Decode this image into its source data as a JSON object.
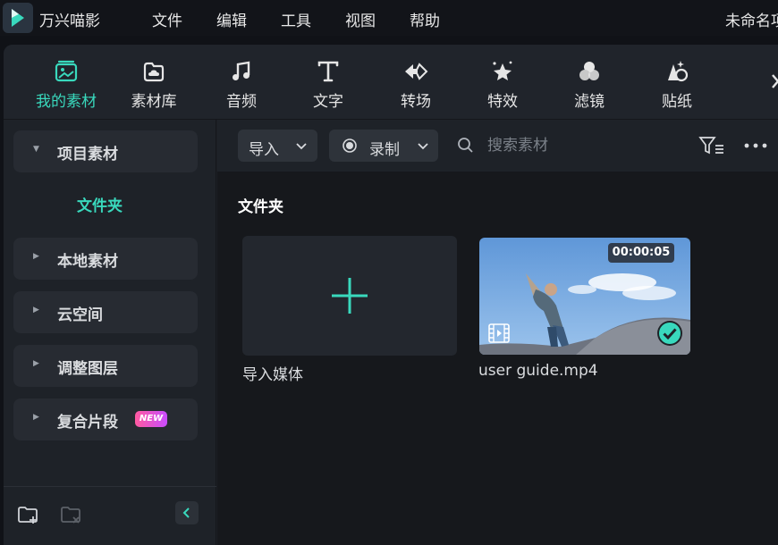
{
  "app": {
    "name": "万兴喵影",
    "project_title": "未命名项",
    "menu": [
      "文件",
      "编辑",
      "工具",
      "视图",
      "帮助"
    ]
  },
  "toolbar": {
    "tabs": [
      {
        "label": "我的素材",
        "icon": "my-media-icon",
        "active": true
      },
      {
        "label": "素材库",
        "icon": "stock-library-icon",
        "active": false
      },
      {
        "label": "音频",
        "icon": "music-note-icon",
        "active": false
      },
      {
        "label": "文字",
        "icon": "text-t-icon",
        "active": false
      },
      {
        "label": "转场",
        "icon": "transition-icon",
        "active": false
      },
      {
        "label": "特效",
        "icon": "sparkle-star-icon",
        "active": false
      },
      {
        "label": "滤镜",
        "icon": "filter-circles-icon",
        "active": false
      },
      {
        "label": "贴纸",
        "icon": "sticker-icon",
        "active": false
      }
    ]
  },
  "sidebar": {
    "items": [
      {
        "label": "项目素材",
        "expanded": true
      },
      {
        "label": "本地素材",
        "expanded": false
      },
      {
        "label": "云空间",
        "expanded": false
      },
      {
        "label": "调整图层",
        "expanded": false
      },
      {
        "label": "复合片段",
        "expanded": false,
        "badge": "NEW"
      }
    ],
    "sub_item": "文件夹"
  },
  "content": {
    "import_label": "导入",
    "record_label": "录制",
    "search_placeholder": "搜索素材",
    "section_title": "文件夹",
    "media": [
      {
        "label": "导入媒体",
        "type": "import"
      },
      {
        "label": "user guide.mp4",
        "type": "video",
        "duration": "00:00:05",
        "selected": true
      }
    ]
  },
  "colors": {
    "accent": "#39d9bd",
    "background": "#1c1f25",
    "badge_gradient": [
      "#ff5aa0",
      "#c94cff"
    ]
  }
}
